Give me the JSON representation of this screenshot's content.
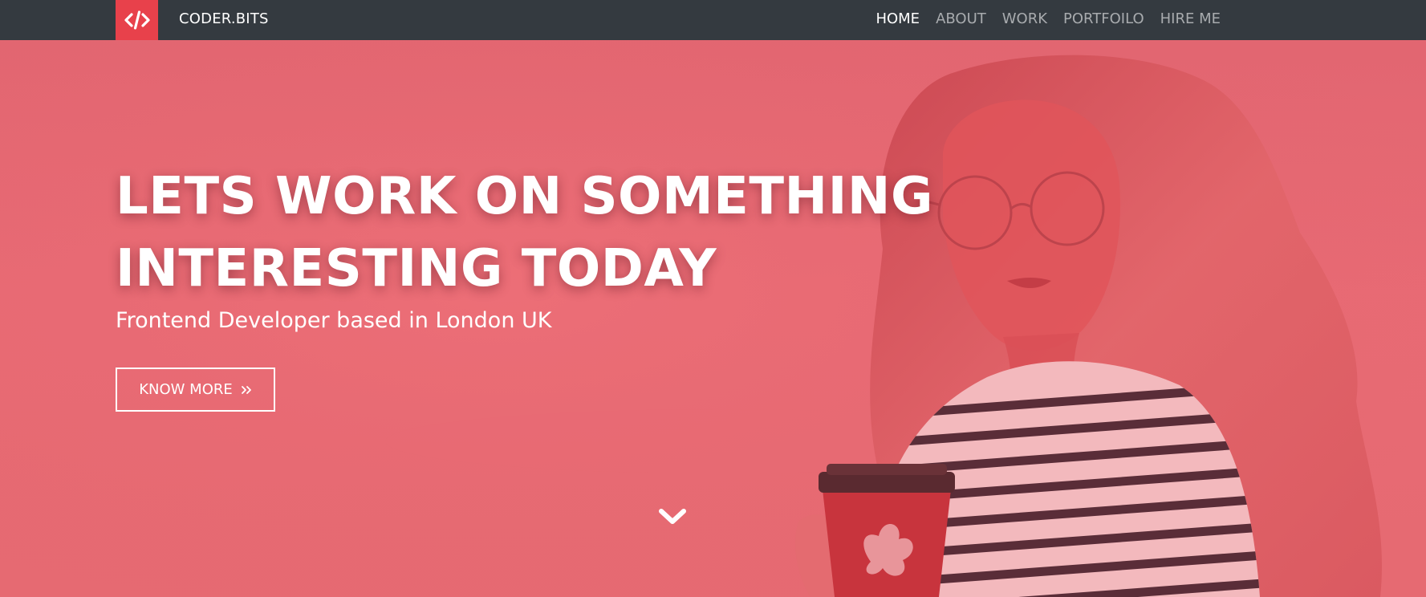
{
  "brand": {
    "logo_icon": "code-slash-icon",
    "name": "CODER.BITS",
    "logo_color": "#e8414b"
  },
  "nav": {
    "items": [
      {
        "label": "HOME",
        "active": true
      },
      {
        "label": "ABOUT",
        "active": false
      },
      {
        "label": "WORK",
        "active": false
      },
      {
        "label": "PORTFOILO",
        "active": false
      },
      {
        "label": "HIRE ME",
        "active": false
      }
    ],
    "background": "#343a40"
  },
  "hero": {
    "title_line1": "LETS WORK ON SOMETHING",
    "title_line2": "INTERESTING TODAY",
    "subtitle": "Frontend Developer based in London UK",
    "cta_label": "KNOW MORE",
    "cta_icon": "double-chevron-right-icon",
    "scroll_icon": "chevron-down-icon",
    "overlay_color": "#e5666f"
  }
}
